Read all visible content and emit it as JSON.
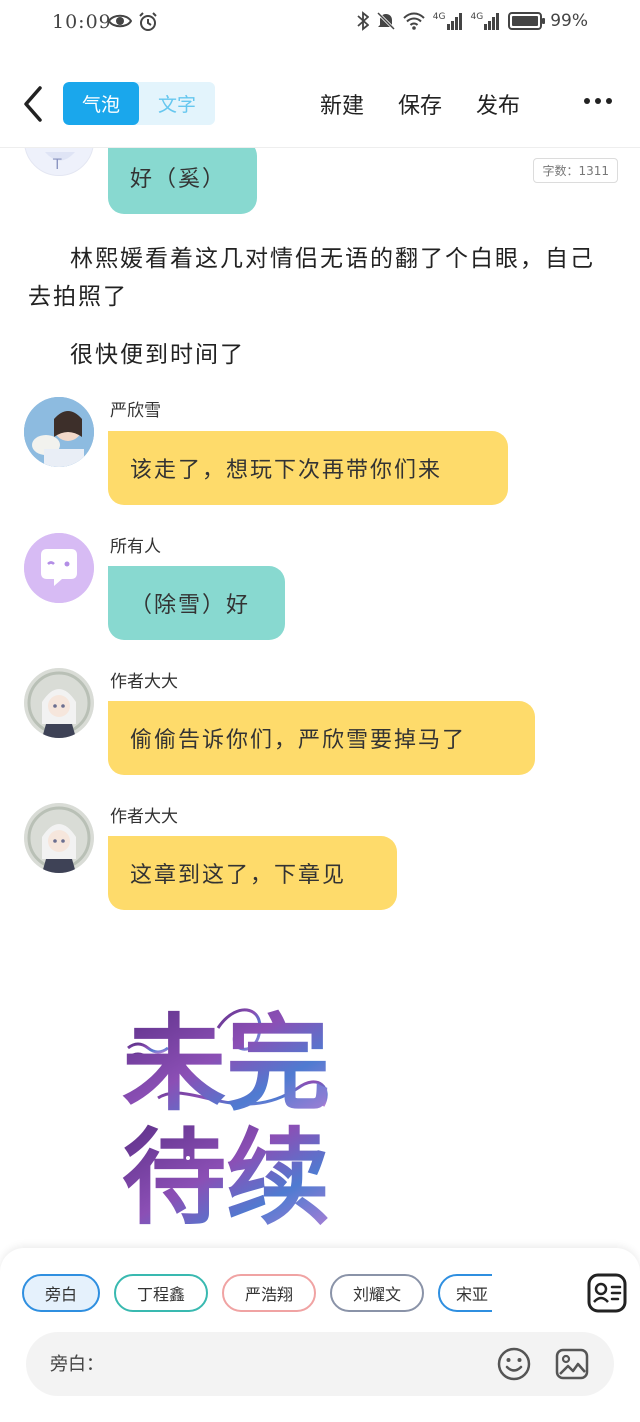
{
  "status_bar": {
    "time": "10:09",
    "signal_1": "4G",
    "signal_2": "4G",
    "battery_percent": "99%",
    "battery_level": 0.99
  },
  "header": {
    "mode_tabs": [
      {
        "label": "气泡",
        "active": true
      },
      {
        "label": "文字",
        "active": false
      }
    ],
    "actions": {
      "new_label": "新建",
      "save_label": "保存",
      "publish_label": "发布"
    }
  },
  "content": {
    "word_count": "字数：1311",
    "messages": [
      {
        "type": "bubble",
        "color": "teal",
        "avatar": "cartoon-avatar",
        "text": "好（奚）"
      },
      {
        "type": "narration",
        "text": "林熙媛看着这几对情侣无语的翻了个白眼，自己去拍照了"
      },
      {
        "type": "narration",
        "text": "很快便到时间了"
      },
      {
        "type": "bubble",
        "color": "yellow",
        "avatar": "photo-avatar",
        "speaker": "严欣雪",
        "text": "该走了，想玩下次再带你们来"
      },
      {
        "type": "bubble",
        "color": "teal",
        "avatar": "chat-bubble-avatar",
        "speaker": "所有人",
        "text": "（除雪）好"
      },
      {
        "type": "bubble",
        "color": "yellow",
        "avatar": "anime-avatar",
        "speaker": "作者大大",
        "text": "偷偷告诉你们，严欣雪要掉马了"
      },
      {
        "type": "bubble",
        "color": "yellow",
        "avatar": "anime-avatar",
        "speaker": "作者大大",
        "text": "这章到这了，下章见"
      }
    ],
    "tbc_image_text": "未完待续"
  },
  "bottom": {
    "chips": [
      "旁白",
      "丁程鑫",
      "严浩翔",
      "刘耀文",
      "宋亚"
    ],
    "input_placeholder": "旁白："
  },
  "colors": {
    "accent": "#1aa7ec",
    "bubble_teal": "#88d9d0",
    "bubble_yellow": "#fedb6b"
  }
}
